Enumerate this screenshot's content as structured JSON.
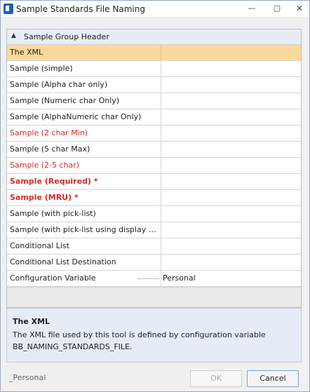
{
  "window": {
    "title": "Sample Standards File Naming",
    "min_label": "—",
    "max_label": "▢",
    "close_label": "✕"
  },
  "grid": {
    "group_toggle": "▲",
    "group_title": "Sample Group Header",
    "rows": [
      {
        "label": "The XML",
        "value": ""
      },
      {
        "label": "Sample (simple)",
        "value": ""
      },
      {
        "label": "Sample (Alpha char only)",
        "value": ""
      },
      {
        "label": "Sample (Numeric char Only)",
        "value": ""
      },
      {
        "label": "Sample (AlphaNumeric char Only)",
        "value": ""
      },
      {
        "label": "Sample (2 char Min)",
        "value": ""
      },
      {
        "label": "Sample (5 char Max)",
        "value": ""
      },
      {
        "label": "Sample (2-5 char)",
        "value": ""
      },
      {
        "label": "Sample (Required) *",
        "value": ""
      },
      {
        "label": "Sample (MRU) *",
        "value": ""
      },
      {
        "label": "Sample (with pick-list)",
        "value": ""
      },
      {
        "label": "Sample (with pick-list using display name)",
        "value": ""
      },
      {
        "label": "Conditional List",
        "value": ""
      },
      {
        "label": "Conditional List Destination",
        "value": ""
      },
      {
        "label": "Configuration Variable",
        "value": "Personal"
      }
    ]
  },
  "description": {
    "title": "The XML",
    "text": "The XML file used by this tool is defined by configuration variable BB_NAMING_STANDARDS_FILE."
  },
  "footer": {
    "status": "_Personal",
    "ok_label": "OK",
    "cancel_label": "Cancel"
  },
  "colors": {
    "selected_row": "#fad99a",
    "error_text": "#d12b2b"
  }
}
